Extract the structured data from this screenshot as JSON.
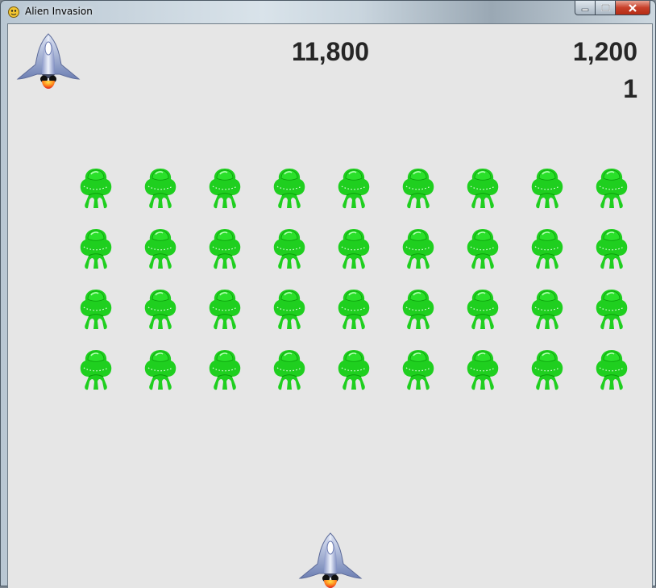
{
  "window": {
    "title": "Alien Invasion",
    "icon": "pygame-snake-icon",
    "controls": [
      "minimize-icon",
      "maximize-icon",
      "close-icon"
    ]
  },
  "scoreboard": {
    "score": "11,800",
    "high_score": "1,200",
    "level": "1",
    "ships_left": 1
  },
  "fleet": {
    "rows": 4,
    "columns": 9,
    "alien_color": "#1fcf1f"
  },
  "player_ship": {
    "icon": "rocket-ship-icon"
  },
  "colors": {
    "background": "#e6e6e6",
    "text": "#262626",
    "alien_green": "#1fcf1f"
  }
}
